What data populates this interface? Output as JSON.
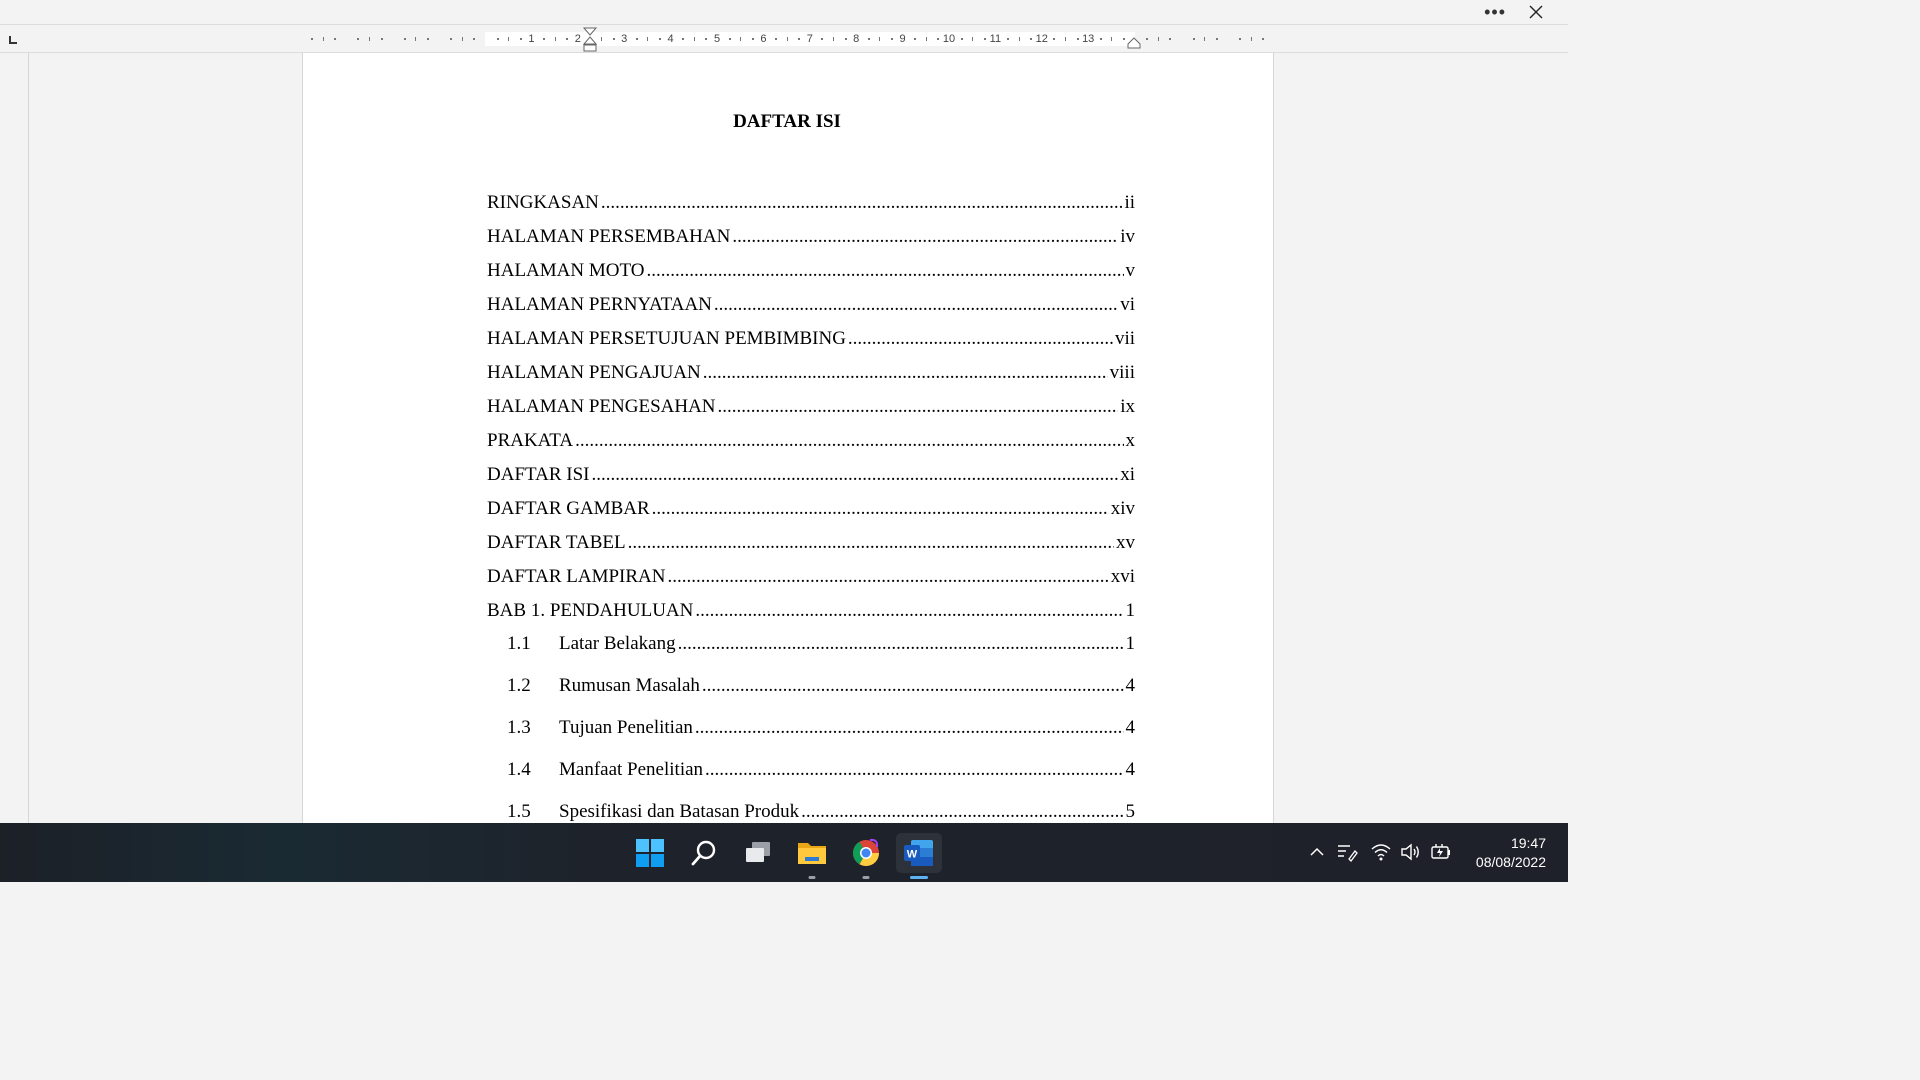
{
  "window": {
    "more_label": "•••",
    "close_icon": "close-icon"
  },
  "ruler": {
    "numbers": [
      "1",
      "2",
      "3",
      "4",
      "5",
      "6",
      "7",
      "8",
      "9",
      "10",
      "11",
      "12",
      "13"
    ]
  },
  "document": {
    "title": "DAFTAR ISI",
    "entries": [
      {
        "label": "RINGKASAN",
        "page": "ii"
      },
      {
        "label": "HALAMAN PERSEMBAHAN",
        "page": "iv"
      },
      {
        "label": "HALAMAN MOTO",
        "page": "v"
      },
      {
        "label": "HALAMAN PERNYATAAN",
        "page": "vi"
      },
      {
        "label": "HALAMAN PERSETUJUAN PEMBIMBING",
        "page": "vii"
      },
      {
        "label": "HALAMAN PENGAJUAN",
        "page": "viii"
      },
      {
        "label": "HALAMAN PENGESAHAN",
        "page": "ix"
      },
      {
        "label": "PRAKATA",
        "page": "x"
      },
      {
        "label": "DAFTAR ISI",
        "page": "xi"
      },
      {
        "label": "DAFTAR GAMBAR",
        "page": "xiv"
      },
      {
        "label": "DAFTAR TABEL",
        "page": "xv"
      },
      {
        "label": "DAFTAR LAMPIRAN",
        "page": "xvi"
      },
      {
        "label": "BAB 1. PENDAHULUAN",
        "page": "1"
      }
    ],
    "subentries": [
      {
        "num": "1.1",
        "label": "Latar Belakang",
        "page": "1"
      },
      {
        "num": "1.2",
        "label": "Rumusan Masalah",
        "page": "4"
      },
      {
        "num": "1.3",
        "label": "Tujuan Penelitian",
        "page": "4"
      },
      {
        "num": "1.4",
        "label": "Manfaat Penelitian",
        "page": "4"
      },
      {
        "num": "1.5",
        "label": "Spesifikasi dan Batasan Produk",
        "page": "5"
      }
    ]
  },
  "taskbar": {
    "apps": [
      "windows-start-icon",
      "search-icon",
      "task-view-icon",
      "file-explorer-icon",
      "chrome-icon",
      "word-icon"
    ],
    "active_app": "word-icon",
    "tray_icons": [
      "chevron-up-icon",
      "pen-menu-icon",
      "wifi-icon",
      "volume-icon",
      "battery-icon"
    ]
  },
  "clock": {
    "time": "19:47",
    "date": "08/08/2022"
  },
  "colors": {
    "accent": "#5fb2f2",
    "word_blue": "#185abd",
    "taskbar_bg": "#1e2129"
  }
}
